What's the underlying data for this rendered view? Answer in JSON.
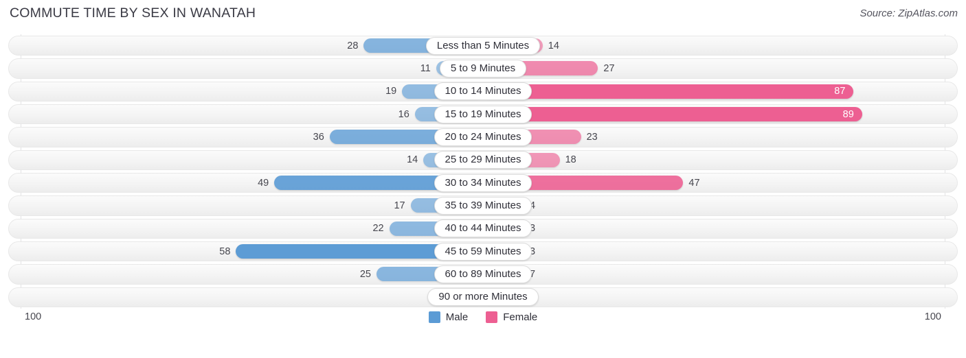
{
  "header": {
    "title": "COMMUTE TIME BY SEX IN WANATAH",
    "source": "Source: ZipAtlas.com"
  },
  "axis": {
    "left_max_label": "100",
    "right_max_label": "100"
  },
  "legend": {
    "items": [
      {
        "label": "Male",
        "color": "#5b9bd5"
      },
      {
        "label": "Female",
        "color": "#ed5f92"
      }
    ]
  },
  "chart_data": {
    "type": "bar",
    "title": "COMMUTE TIME BY SEX IN WANATAH",
    "subtitle": "Source: ZipAtlas.com",
    "orientation": "horizontal-diverging",
    "xlabel": "",
    "ylabel": "",
    "xlim": [
      100,
      100
    ],
    "grid": true,
    "legend_position": "bottom-center",
    "categories": [
      "Less than 5 Minutes",
      "5 to 9 Minutes",
      "10 to 14 Minutes",
      "15 to 19 Minutes",
      "20 to 24 Minutes",
      "25 to 29 Minutes",
      "30 to 34 Minutes",
      "35 to 39 Minutes",
      "40 to 44 Minutes",
      "45 to 59 Minutes",
      "60 to 89 Minutes",
      "90 or more Minutes"
    ],
    "series": [
      {
        "name": "Male",
        "color": "#5b9bd5",
        "side": "left",
        "values": [
          28,
          11,
          19,
          16,
          36,
          14,
          49,
          17,
          22,
          58,
          25,
          0
        ]
      },
      {
        "name": "Female",
        "color": "#ed5f92",
        "side": "right",
        "values": [
          14,
          27,
          87,
          89,
          23,
          18,
          47,
          4,
          3,
          3,
          7,
          0
        ]
      }
    ],
    "rows": [
      {
        "label": "Less than 5 Minutes",
        "male": 28,
        "female": 14,
        "male_text": "28",
        "female_text": "14",
        "female_inside": false
      },
      {
        "label": "5 to 9 Minutes",
        "male": 11,
        "female": 27,
        "male_text": "11",
        "female_text": "27",
        "female_inside": false
      },
      {
        "label": "10 to 14 Minutes",
        "male": 19,
        "female": 87,
        "male_text": "19",
        "female_text": "87",
        "female_inside": true
      },
      {
        "label": "15 to 19 Minutes",
        "male": 16,
        "female": 89,
        "male_text": "16",
        "female_text": "89",
        "female_inside": true
      },
      {
        "label": "20 to 24 Minutes",
        "male": 36,
        "female": 23,
        "male_text": "36",
        "female_text": "23",
        "female_inside": false
      },
      {
        "label": "25 to 29 Minutes",
        "male": 14,
        "female": 18,
        "male_text": "14",
        "female_text": "18",
        "female_inside": false
      },
      {
        "label": "30 to 34 Minutes",
        "male": 49,
        "female": 47,
        "male_text": "49",
        "female_text": "47",
        "female_inside": false
      },
      {
        "label": "35 to 39 Minutes",
        "male": 17,
        "female": 4,
        "male_text": "17",
        "female_text": "4",
        "female_inside": false
      },
      {
        "label": "40 to 44 Minutes",
        "male": 22,
        "female": 3,
        "male_text": "22",
        "female_text": "3",
        "female_inside": false
      },
      {
        "label": "45 to 59 Minutes",
        "male": 58,
        "female": 3,
        "male_text": "58",
        "female_text": "3",
        "female_inside": false
      },
      {
        "label": "60 to 89 Minutes",
        "male": 25,
        "female": 7,
        "male_text": "25",
        "female_text": "7",
        "female_inside": false
      },
      {
        "label": "90 or more Minutes",
        "male": 0,
        "female": 0,
        "male_text": "0",
        "female_text": "0",
        "female_inside": false
      }
    ]
  }
}
